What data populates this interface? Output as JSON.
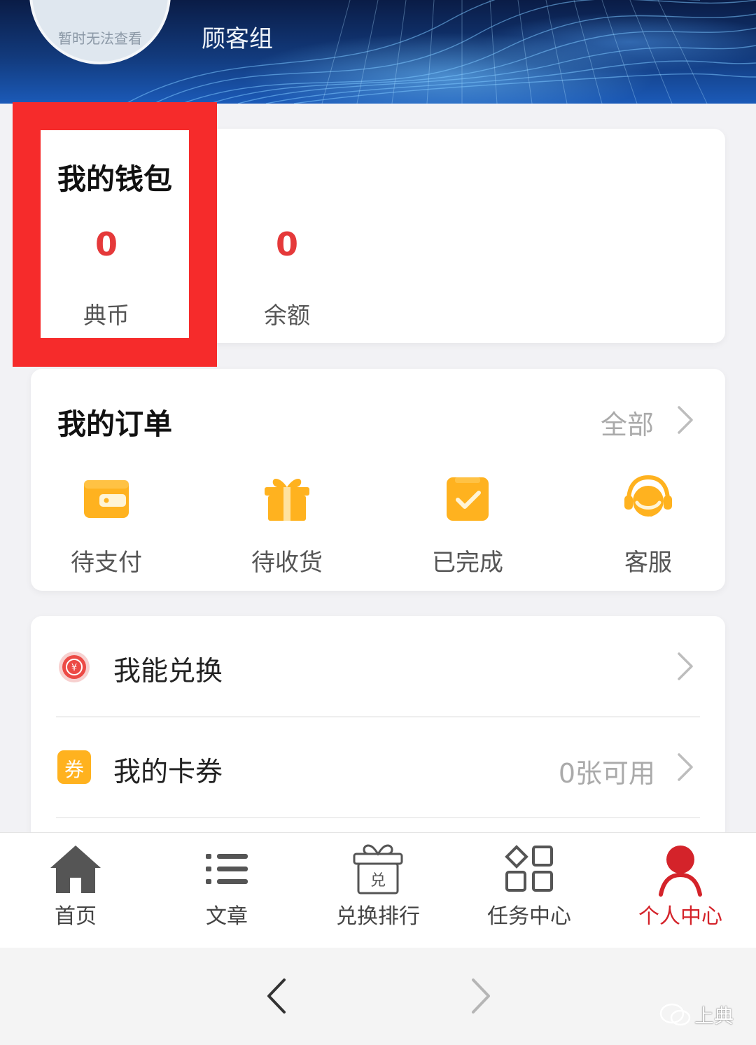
{
  "header": {
    "avatar_text": "暂时无法查看",
    "group_name": "顾客组"
  },
  "wallet": {
    "title": "我的钱包",
    "items": [
      {
        "value": "0",
        "label": "典币"
      },
      {
        "value": "0",
        "label": "余额"
      }
    ]
  },
  "orders": {
    "title": "我的订单",
    "all_label": "全部",
    "items": [
      {
        "label": "待支付",
        "icon": "wallet-icon"
      },
      {
        "label": "待收货",
        "icon": "gift-icon"
      },
      {
        "label": "已完成",
        "icon": "checkmark-clipboard-icon"
      },
      {
        "label": "客服",
        "icon": "headset-icon"
      }
    ]
  },
  "menu": {
    "items": [
      {
        "label": "我能兑换",
        "value": "",
        "icon": "yuan-coin-icon"
      },
      {
        "label": "我的卡券",
        "value": "0张可用",
        "icon": "coupon-icon",
        "icon_text": "券"
      }
    ]
  },
  "tabbar": {
    "items": [
      {
        "label": "首页",
        "icon": "home-icon",
        "active": false
      },
      {
        "label": "文章",
        "icon": "list-icon",
        "active": false
      },
      {
        "label": "兑换排行",
        "icon": "gift-box-icon",
        "icon_text": "兑",
        "active": false
      },
      {
        "label": "任务中心",
        "icon": "grid-icon",
        "active": false
      },
      {
        "label": "个人中心",
        "icon": "person-icon",
        "active": true
      }
    ]
  },
  "watermark": "上典",
  "colors": {
    "accent_red": "#e5393a",
    "highlight_red": "#f62b2b",
    "active_tab_red": "#d4232a",
    "order_icon_orange": "#ffb21f"
  }
}
